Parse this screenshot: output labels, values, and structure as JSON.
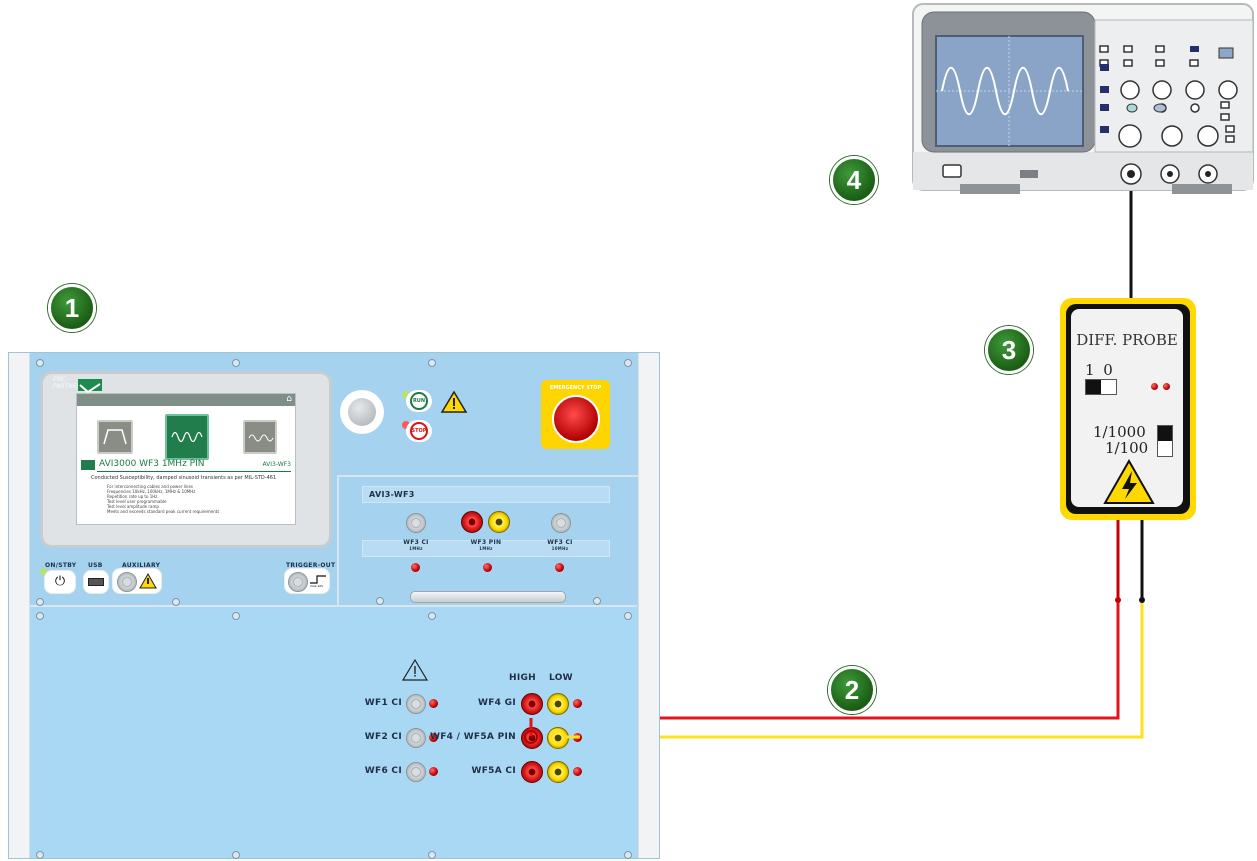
{
  "badges": {
    "one": "1",
    "two": "2",
    "three": "3",
    "four": "4"
  },
  "generator": {
    "brand_line1": "EMC -",
    "brand_line2": "PARTNER",
    "screen_title": "AVI3000  WF3 1MHz PIN",
    "screen_tag": "AVI3-WF3",
    "screen_desc": "Conducted Susceptibility, damped sinusoid transients as per MIL-STD-461",
    "screen_bullets": [
      "For interconnecting cables and power lines",
      "Frequencies 10kHz, 100kHz, 1MHz & 10MHz",
      "Repetition rate up to 1Hz",
      "Test level user programmable",
      "Test level amplitude ramp",
      "Meets and exceeds standard peak current requirements"
    ],
    "run_label": "RUN",
    "stop_label": "STOP",
    "emergency_label": "EMERGENCY STOP",
    "onstby_label": "ON/STBY",
    "usb_label": "USB",
    "auxiliary_label": "AUXILIARY",
    "trigger_label": "TRIGGER-OUT",
    "trigger_sub": "max.10V",
    "module_title": "AVI3-WF3",
    "module_ports": [
      {
        "label": "WF3 CI",
        "sub": "1MHz"
      },
      {
        "label": "WF3  PIN",
        "sub": "1MHz"
      },
      {
        "label": "WF3  CI",
        "sub": "10MHz"
      }
    ],
    "high_label": "HIGH",
    "low_label": "LOW",
    "left_ports": [
      "WF1 CI",
      "WF2 CI",
      "WF6 CI"
    ],
    "right_ports": [
      "WF4 GI",
      "WF4 / WF5A PIN",
      "WF5A CI"
    ]
  },
  "probe": {
    "title": "DIFF. PROBE",
    "switch1_label": "1 0",
    "range_high": "1/1000",
    "range_low": "1/100"
  },
  "colors": {
    "panel": "#a5d3ef",
    "badge": "#1f6b1a",
    "probe_border": "#ffd800",
    "wire_red": "#e0141b",
    "wire_yellow": "#ffe21a"
  }
}
